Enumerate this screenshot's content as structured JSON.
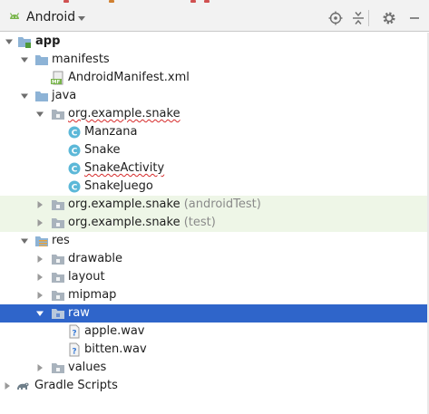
{
  "toolbar": {
    "view_label": "Android",
    "icons": [
      "android-icon",
      "chevron-down-icon",
      "locate-icon",
      "collapse-all-icon",
      "gear-icon",
      "minimize-icon"
    ]
  },
  "tree": {
    "app": "app",
    "manifests": "manifests",
    "android_manifest": "AndroidManifest.xml",
    "java": "java",
    "package_main": "org.example.snake",
    "class_manzana": "Manzana",
    "class_snake": "Snake",
    "class_snake_activity": "SnakeActivity",
    "class_snake_juego": "SnakeJuego",
    "package_android_test": "org.example.snake",
    "package_android_test_suffix": "(androidTest)",
    "package_test": "org.example.snake",
    "package_test_suffix": "(test)",
    "res": "res",
    "drawable": "drawable",
    "layout": "layout",
    "mipmap": "mipmap",
    "raw": "raw",
    "apple_wav": "apple.wav",
    "bitten_wav": "bitten.wav",
    "values": "values",
    "gradle_scripts": "Gradle Scripts",
    "manifest_badge": "MF",
    "class_badge": "C",
    "unknown_file_badge": "?"
  },
  "colors": {
    "selection": "#2f65ca",
    "test_row_tint": "#eef6e7",
    "folder_blue": "#8db3d6",
    "class_icon": "#5cb8d8",
    "android_green": "#78b44a",
    "spelling_squiggle": "#d62b2b"
  }
}
